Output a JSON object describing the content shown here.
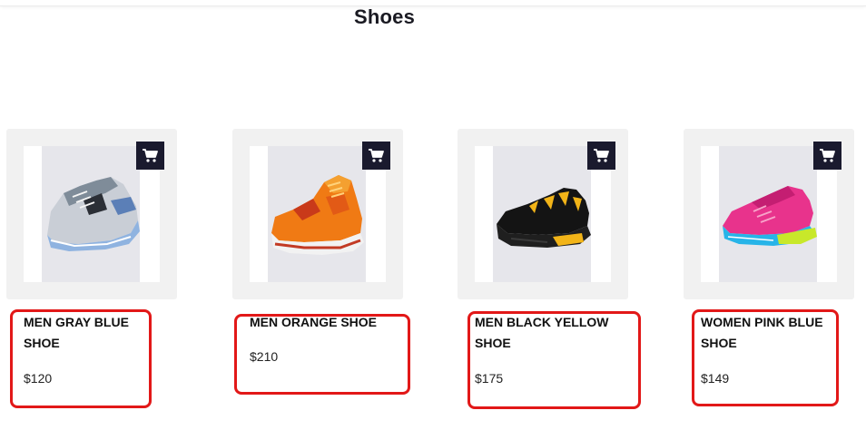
{
  "page": {
    "title": "Shoes"
  },
  "products": [
    {
      "name_line1": "MEN GRAY BLUE",
      "name_line2": "SHOE",
      "price": "$120",
      "cart_icon": "cart-icon",
      "image": "gray-blue-sneaker"
    },
    {
      "name_line1": "MEN ORANGE SHOE",
      "name_line2": "",
      "price": "$210",
      "cart_icon": "cart-icon",
      "image": "orange-high-top-sneaker"
    },
    {
      "name_line1": "MEN BLACK YELLOW",
      "name_line2": "SHOE",
      "price": "$175",
      "cart_icon": "cart-icon",
      "image": "black-yellow-sneaker"
    },
    {
      "name_line1": "WOMEN PINK BLUE",
      "name_line2": "SHOE",
      "price": "$149",
      "cart_icon": "cart-icon",
      "image": "pink-blue-sneaker"
    }
  ],
  "colors": {
    "highlight": "#e21818",
    "cart_button": "#1a1a2e",
    "card_bg": "#f1f1f1"
  }
}
